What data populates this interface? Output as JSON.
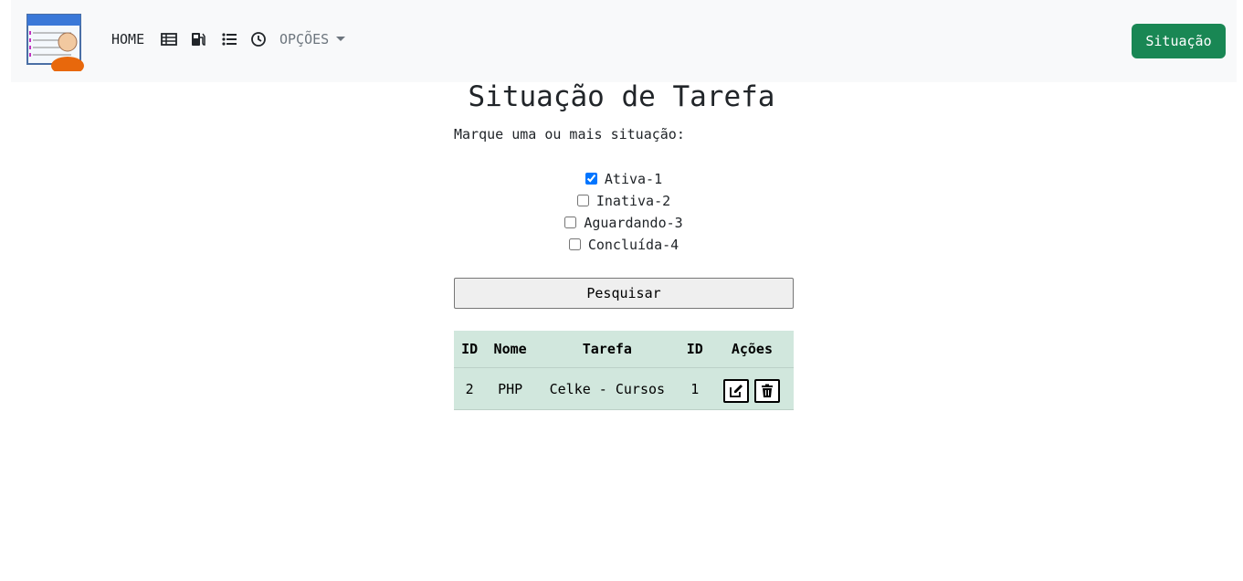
{
  "nav": {
    "home": "HOME",
    "icons": [
      "table-icon",
      "gas-pump-icon",
      "list-icon",
      "clock-icon"
    ],
    "options": "OPÇÕES",
    "status_button": "Situação"
  },
  "page": {
    "title": "Situação de Tarefa",
    "subtitle": "Marque uma ou mais situação:"
  },
  "checkboxes": [
    {
      "label": "Ativa-1",
      "checked": true
    },
    {
      "label": "Inativa-2",
      "checked": false
    },
    {
      "label": "Aguardando-3",
      "checked": false
    },
    {
      "label": "Concluída-4",
      "checked": false
    }
  ],
  "search_button": "Pesquisar",
  "table": {
    "headers": [
      "ID",
      "Nome",
      "Tarefa",
      "ID",
      "Ações"
    ],
    "rows": [
      {
        "id": "2",
        "nome": "PHP",
        "tarefa": "Celke - Cursos",
        "id2": "1"
      }
    ]
  },
  "colors": {
    "navbar_bg": "#f8f9fa",
    "accent_green": "#198754",
    "table_bg": "#d1e7dd"
  }
}
